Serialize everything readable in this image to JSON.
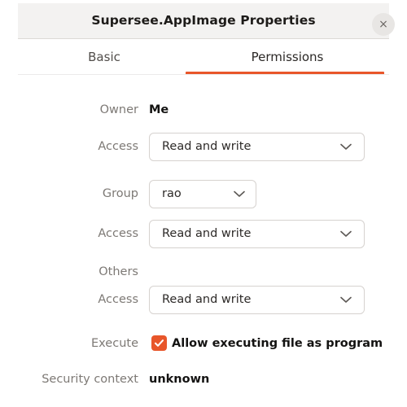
{
  "window": {
    "title": "Supersee.AppImage Properties",
    "close_icon": "close-icon",
    "close_glyph": "×"
  },
  "tabs": {
    "items": [
      {
        "label": "Basic",
        "active": false
      },
      {
        "label": "Permissions",
        "active": true
      }
    ],
    "active_label": "Permissions",
    "inactive_label": "Basic",
    "accent_color": "#e8562a"
  },
  "permissions": {
    "owner": {
      "label": "Owner",
      "value": "Me"
    },
    "owner_access": {
      "label": "Access",
      "value": "Read and write"
    },
    "group": {
      "label": "Group",
      "value": "rao"
    },
    "group_access": {
      "label": "Access",
      "value": "Read and write"
    },
    "others": {
      "label": "Others",
      "value": ""
    },
    "others_access": {
      "label": "Access",
      "value": "Read and write"
    },
    "execute": {
      "label": "Execute",
      "checkbox_label": "Allow executing file as program",
      "checked": true,
      "checkbox_color": "#e8562a"
    },
    "security_context": {
      "label": "Security context",
      "value": "unknown"
    }
  },
  "icons": {
    "chevron_down": "chevron-down-icon",
    "check": "check-icon"
  }
}
